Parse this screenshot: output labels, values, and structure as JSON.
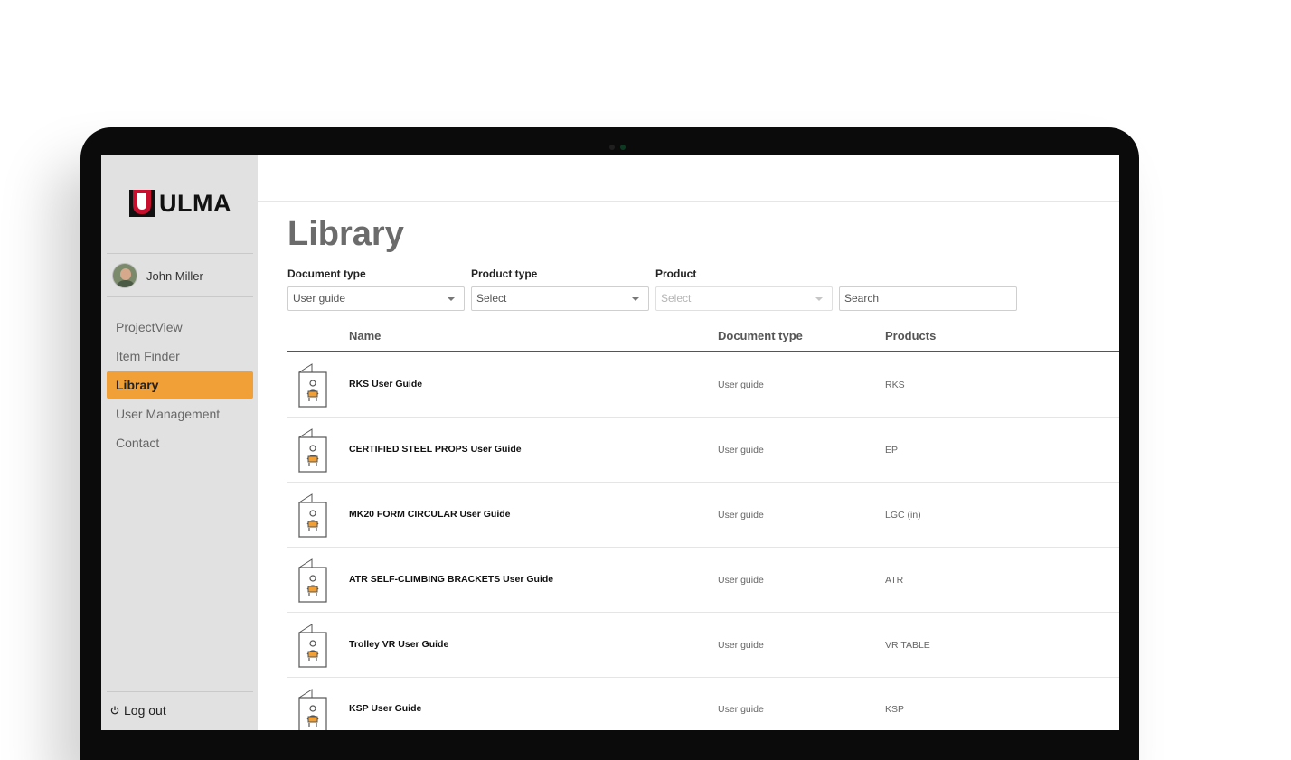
{
  "app": {
    "brand": "ULMA"
  },
  "user": {
    "name": "John Miller"
  },
  "nav": [
    {
      "label": "ProjectView",
      "active": false
    },
    {
      "label": "Item Finder",
      "active": false
    },
    {
      "label": "Library",
      "active": true
    },
    {
      "label": "User Management",
      "active": false
    },
    {
      "label": "Contact",
      "active": false
    }
  ],
  "logout_label": "Log out",
  "page": {
    "title": "Library"
  },
  "filters": {
    "document_type": {
      "label": "Document type",
      "value": "User guide"
    },
    "product_type": {
      "label": "Product type",
      "value": "Select"
    },
    "product": {
      "label": "Product",
      "value": "Select",
      "disabled": true
    },
    "search": {
      "placeholder": "Search"
    }
  },
  "table": {
    "columns": [
      "Name",
      "Document type",
      "Products"
    ],
    "rows": [
      {
        "name": "RKS User Guide",
        "doc_type": "User guide",
        "products": "RKS",
        "icon": "user-guide-icon"
      },
      {
        "name": "CERTIFIED STEEL PROPS User Guide",
        "doc_type": "User guide",
        "products": "EP",
        "icon": "user-guide-icon"
      },
      {
        "name": "MK20 FORM CIRCULAR User Guide",
        "doc_type": "User guide",
        "products": "LGC (in)",
        "icon": "user-guide-icon"
      },
      {
        "name": "ATR SELF-CLIMBING BRACKETS User Guide",
        "doc_type": "User guide",
        "products": "ATR",
        "icon": "user-guide-icon"
      },
      {
        "name": "Trolley VR User Guide",
        "doc_type": "User guide",
        "products": "VR TABLE",
        "icon": "user-guide-icon"
      },
      {
        "name": "KSP User Guide",
        "doc_type": "User guide",
        "products": "KSP",
        "icon": "user-guide-icon"
      }
    ]
  },
  "colors": {
    "accent": "#f0a037",
    "sidebar": "#e1e1e1",
    "brand_red": "#c8102e"
  }
}
